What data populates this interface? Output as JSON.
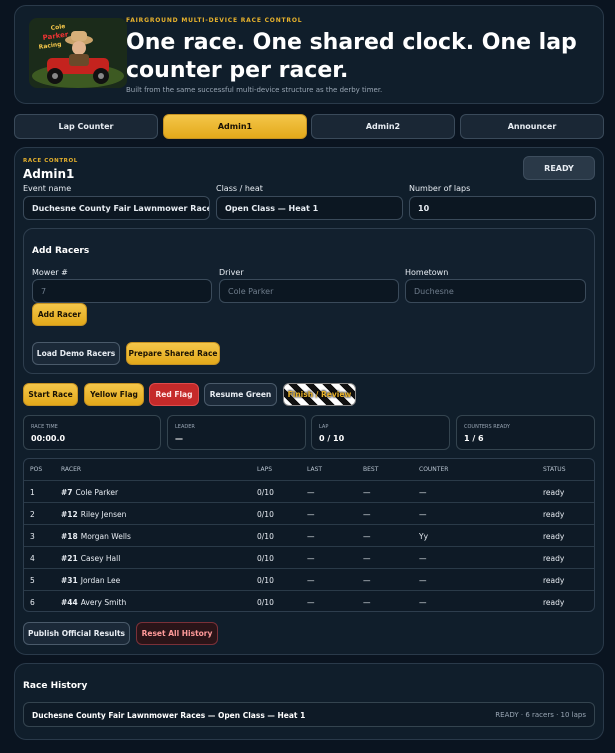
{
  "hero": {
    "logo_text": "Cole Parker Racing",
    "kicker": "FAIRGROUND MULTI-DEVICE RACE CONTROL",
    "headline": "One race. One shared clock. One lap counter per racer.",
    "subtitle": "Built from the same successful multi-device structure as the derby timer."
  },
  "tabs": [
    {
      "label": "Lap Counter",
      "active": false
    },
    {
      "label": "Admin1",
      "active": true
    },
    {
      "label": "Admin2",
      "active": false
    },
    {
      "label": "Announcer",
      "active": false
    }
  ],
  "race_control": {
    "kicker": "RACE CONTROL",
    "title": "Admin1",
    "status_badge": "READY",
    "event_name_label": "Event name",
    "event_name_value": "Duchesne County Fair Lawnmower Races",
    "class_label": "Class / heat",
    "class_value": "Open Class — Heat 1",
    "laps_label": "Number of laps",
    "laps_value": "10"
  },
  "add_racers": {
    "title": "Add Racers",
    "mower_label": "Mower #",
    "mower_placeholder": "7",
    "driver_label": "Driver",
    "driver_placeholder": "Cole Parker",
    "hometown_label": "Hometown",
    "hometown_placeholder": "Duchesne",
    "add_button": "Add Racer",
    "demo_button": "Load Demo Racers",
    "prepare_button": "Prepare Shared Race"
  },
  "controls": {
    "start": "Start Race",
    "yellow": "Yellow Flag",
    "red": "Red Flag",
    "resume": "Resume Green",
    "finish": "Finish / Review"
  },
  "stats": [
    {
      "key": "RACE TIME",
      "value": "00:00.0"
    },
    {
      "key": "LEADER",
      "value": "—"
    },
    {
      "key": "LAP",
      "value": "0 / 10"
    },
    {
      "key": "COUNTERS READY",
      "value": "1 / 6"
    }
  ],
  "table": {
    "headers": {
      "pos": "POS",
      "racer": "RACER",
      "laps": "LAPS",
      "last": "LAST",
      "best": "BEST",
      "counter": "COUNTER",
      "status": "STATUS"
    },
    "rows": [
      {
        "pos": "1",
        "num": "#7",
        "name": "Cole Parker",
        "laps": "0/10",
        "last": "—",
        "best": "—",
        "counter": "—",
        "status": "ready"
      },
      {
        "pos": "2",
        "num": "#12",
        "name": "Riley Jensen",
        "laps": "0/10",
        "last": "—",
        "best": "—",
        "counter": "—",
        "status": "ready"
      },
      {
        "pos": "3",
        "num": "#18",
        "name": "Morgan Wells",
        "laps": "0/10",
        "last": "—",
        "best": "—",
        "counter": "Yy",
        "status": "ready"
      },
      {
        "pos": "4",
        "num": "#21",
        "name": "Casey Hall",
        "laps": "0/10",
        "last": "—",
        "best": "—",
        "counter": "—",
        "status": "ready"
      },
      {
        "pos": "5",
        "num": "#31",
        "name": "Jordan Lee",
        "laps": "0/10",
        "last": "—",
        "best": "—",
        "counter": "—",
        "status": "ready"
      },
      {
        "pos": "6",
        "num": "#44",
        "name": "Avery Smith",
        "laps": "0/10",
        "last": "—",
        "best": "—",
        "counter": "—",
        "status": "ready"
      }
    ]
  },
  "results": {
    "publish": "Publish Official Results",
    "reset": "Reset All History"
  },
  "history": {
    "title": "Race History",
    "entries": [
      {
        "name": "Duchesne County Fair Lawnmower Races — Open Class — Heat 1",
        "meta": "READY · 6 racers · 10 laps"
      }
    ]
  },
  "colors": {
    "accent_gold": "#e7b22c",
    "danger_red": "#c52a2a",
    "page_bg": "#0a1420",
    "panel_bg": "#101e2b"
  }
}
